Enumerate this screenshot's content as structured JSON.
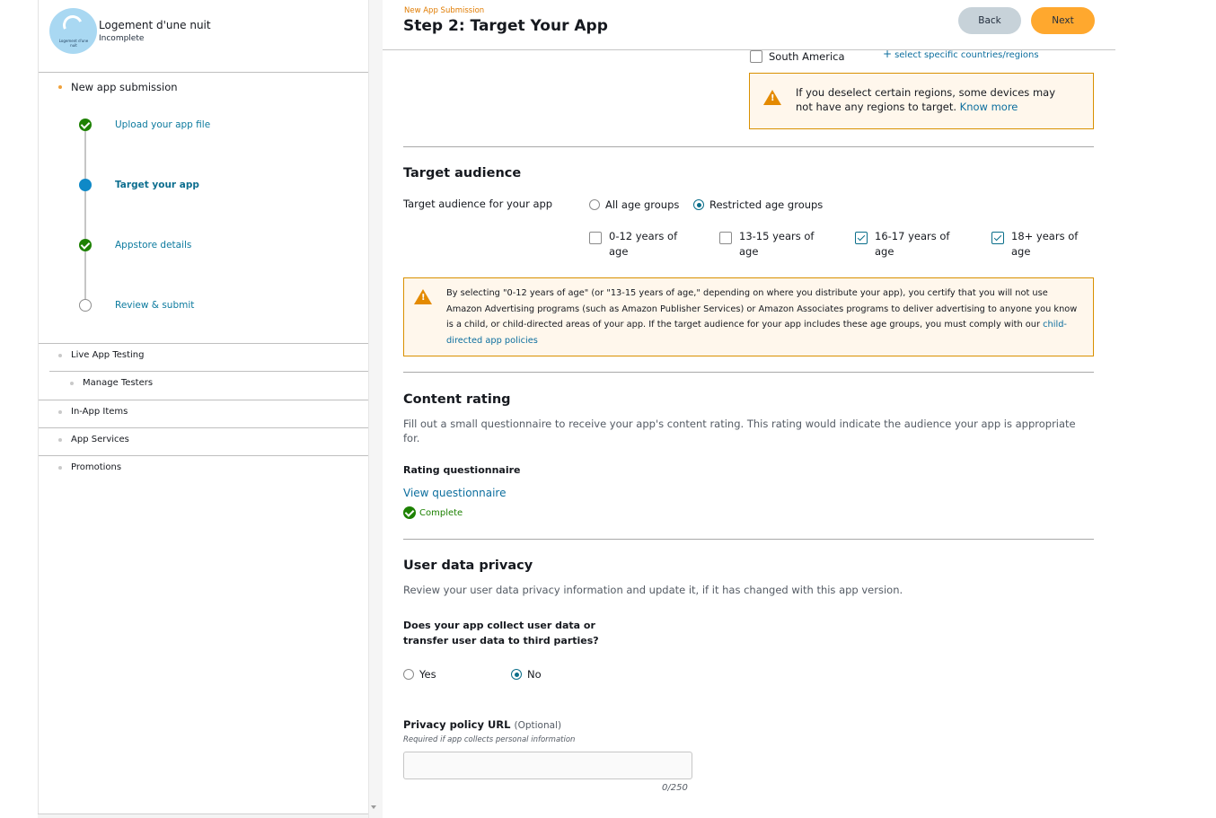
{
  "app": {
    "name": "Logement d'une nuit",
    "status": "Incomplete",
    "avatar_text": "Logement d'une nuit"
  },
  "sidebar": {
    "section_label": "New app submission",
    "steps": [
      {
        "label": "Upload your app file",
        "state": "done"
      },
      {
        "label": "Target your app",
        "state": "current"
      },
      {
        "label": "Appstore details",
        "state": "done"
      },
      {
        "label": "Review & submit",
        "state": "todo"
      }
    ],
    "items": [
      {
        "label": "Live App Testing"
      },
      {
        "label": "Manage Testers"
      },
      {
        "label": "In-App Items"
      },
      {
        "label": "App Services"
      },
      {
        "label": "Promotions"
      }
    ]
  },
  "header": {
    "breadcrumb": "New App Submission",
    "title": "Step 2: Target Your App",
    "back_label": "Back",
    "next_label": "Next"
  },
  "regions": {
    "south_america_label": "South America",
    "select_link": "select specific countries/regions",
    "warning_text": "If you deselect certain regions, some devices may not have any regions to target.",
    "know_more": "Know more"
  },
  "target_audience": {
    "title": "Target audience",
    "field_label": "Target audience for your app",
    "all_ages_label": "All age groups",
    "restricted_label": "Restricted age groups",
    "selected": "Restricted age groups",
    "age_groups": [
      {
        "label": "0-12 years of age",
        "checked": false
      },
      {
        "label": "13-15 years of age",
        "checked": false
      },
      {
        "label": "16-17 years of age",
        "checked": true
      },
      {
        "label": "18+ years of age",
        "checked": true
      }
    ],
    "warning_text": "By selecting \"0-12 years of age\" (or \"13-15 years of age,\" depending on where you distribute your app), you certify that you will not use Amazon Advertising programs (such as Amazon Publisher Services) or Amazon Associates programs to deliver advertising to anyone you know is a child, or child-directed areas of your app. If the target audience for your app includes these age groups, you must comply with our",
    "warning_link": "child-directed app policies"
  },
  "content_rating": {
    "title": "Content rating",
    "description": "Fill out a small questionnaire to receive your app's content rating. This rating would indicate the audience your app is appropriate for.",
    "questionnaire_label": "Rating questionnaire",
    "view_link": "View questionnaire",
    "status": "Complete"
  },
  "privacy": {
    "title": "User data privacy",
    "description": "Review your user data privacy information and update it, if it has changed with this app version.",
    "question": "Does your app collect user data or transfer user data to third parties?",
    "yes_label": "Yes",
    "no_label": "No",
    "selected": "No",
    "url_label": "Privacy policy URL",
    "url_optional": "(Optional)",
    "url_hint": "Required if app collects personal information",
    "url_value": "",
    "url_placeholder": "",
    "counter": "0/250"
  },
  "colors": {
    "accent_orange": "#ffa82e",
    "link_blue": "#0c6e9e",
    "success_green": "#1d8102",
    "warning_border": "#d99000"
  }
}
